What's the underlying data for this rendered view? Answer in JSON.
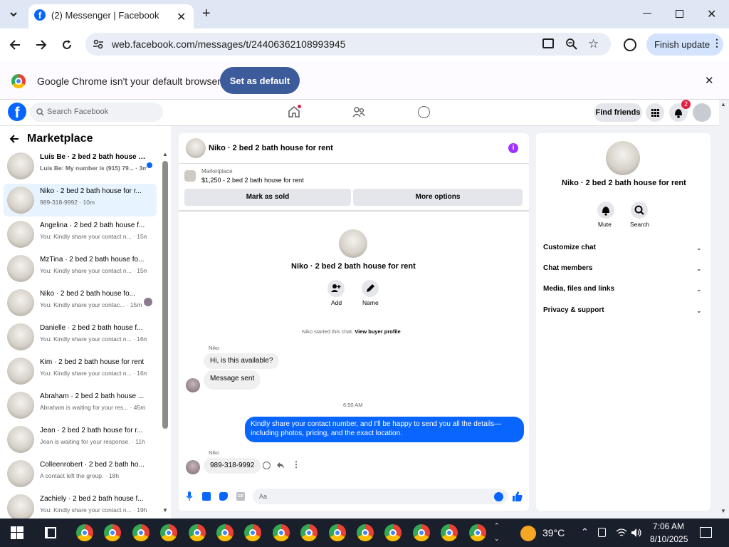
{
  "browser": {
    "tab_title": "(2) Messenger | Facebook",
    "url": "web.facebook.com/messages/t/24406362108993945",
    "finish_update": "Finish update",
    "infobar_message": "Google Chrome isn't your default browser",
    "set_default": "Set as default"
  },
  "fb_header": {
    "search_placeholder": "Search Facebook",
    "find_friends": "Find friends",
    "notif_count": "2"
  },
  "sidebar": {
    "title": "Marketplace",
    "conversations": [
      {
        "name": "Luis Be · 2 bed 2 bath house f...",
        "preview": "Luis Be: My number is (915) 79... · 3m",
        "unread": true
      },
      {
        "name": "Niko · 2 bed 2 bath house for r...",
        "preview": "989-318-9992 · 10m",
        "selected": true
      },
      {
        "name": "Angelina · 2 bed 2 bath house f...",
        "preview": "You: Kindly share your contact n... · 15m"
      },
      {
        "name": "MzTina · 2 bed 2 bath house fo...",
        "preview": "You: Kindly share your contact n... · 15m"
      },
      {
        "name": "Niko · 2 bed 2 bath house fo...",
        "preview": "You: Kindly share your contac... · 15m",
        "seen": true
      },
      {
        "name": "Danielle · 2 bed 2 bath house f...",
        "preview": "You: Kindly share your contact n... · 16m"
      },
      {
        "name": "Kim · 2 bed 2 bath house for rent",
        "preview": "You: Kindly share your contact n... · 16m"
      },
      {
        "name": "Abraham · 2 bed 2 bath house ...",
        "preview": "Abraham is waiting for your res... · 45m"
      },
      {
        "name": "Jean · 2 bed 2 bath house for r...",
        "preview": "Jean is waiting for your response. · 11h"
      },
      {
        "name": "Colleenrobert · 2 bed 2 bath ho...",
        "preview": "A contact left the group. · 18h"
      },
      {
        "name": "Zachiely · 2 bed 2 bath house f...",
        "preview": "You: Kindly share your contact n... · 19h"
      }
    ]
  },
  "chat": {
    "header_title": "Niko · 2 bed 2 bath house for rent",
    "listing_label": "Marketplace",
    "listing_detail": "$1,250 - 2 bed 2 bath house for rent",
    "mark_sold": "Mark as sold",
    "more_options": "More options",
    "profile_name": "Niko · 2 bed 2 bath house for rent",
    "add_label": "Add",
    "name_label": "Name",
    "started_text": "Niko started this chat.",
    "view_buyer": "View buyer profile",
    "sender_name_1": "Niko",
    "msg_1": "Hi, is this available?",
    "msg_2": "Message sent",
    "time_divider": "6:50 AM",
    "my_msg": "Kindly share your contact number, and I'll be happy to send you all the details—including photos, pricing, and the exact location.",
    "sender_name_2": "Niko",
    "msg_3": "989-318-9992",
    "input_placeholder": "Aa"
  },
  "details": {
    "title": "Niko · 2 bed 2 bath house for rent",
    "mute": "Mute",
    "search": "Search",
    "sections": [
      "Customize chat",
      "Chat members",
      "Media, files and links",
      "Privacy & support"
    ]
  },
  "taskbar": {
    "weather": "39°C",
    "time": "7:06 AM",
    "date": "8/10/2025"
  },
  "colors": {
    "fb_blue": "#0866ff",
    "chrome_button": "#3b5b9a"
  }
}
